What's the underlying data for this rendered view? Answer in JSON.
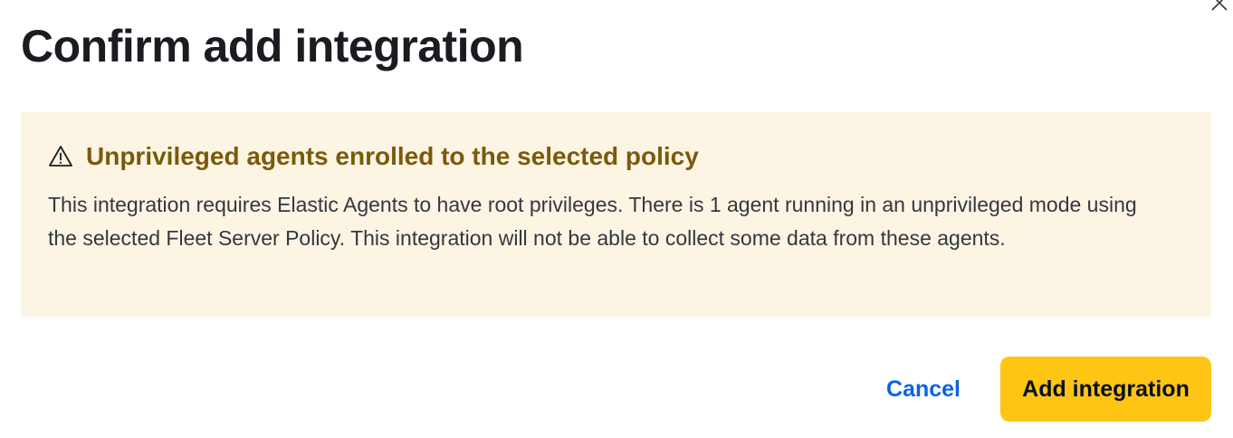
{
  "modal": {
    "title": "Confirm add integration",
    "close_icon": "close-icon"
  },
  "callout": {
    "icon": "warning-icon",
    "title": "Unprivileged agents enrolled to the selected policy",
    "body": "This integration requires Elastic Agents to have root privileges. There is 1 agent running in an unprivileged mode using the selected Fleet Server Policy. This integration will not be able to collect some data from these agents.",
    "colors": {
      "background": "#fdf5e3",
      "title": "#7a5a0b"
    }
  },
  "footer": {
    "cancel_label": "Cancel",
    "confirm_label": "Add integration",
    "colors": {
      "cancel": "#0b64dd",
      "confirm_bg": "#fec514"
    }
  }
}
